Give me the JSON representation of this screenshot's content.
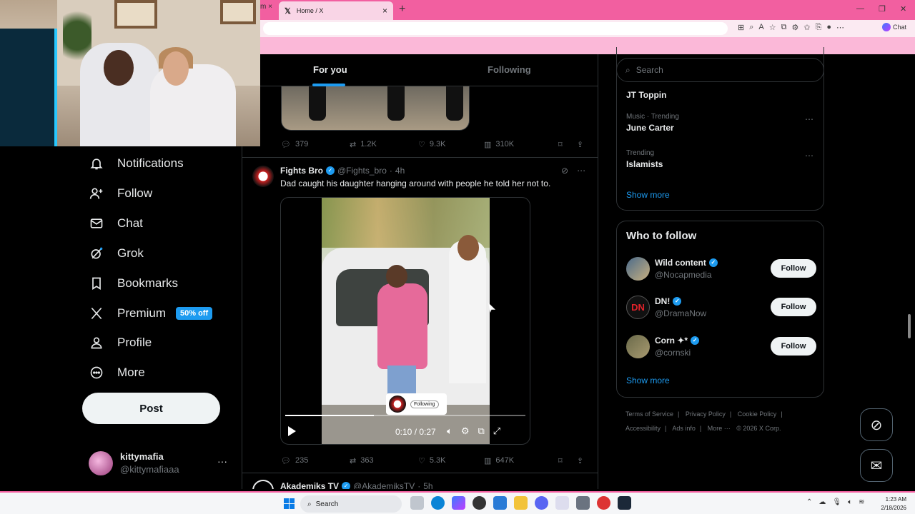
{
  "browser": {
    "tab_title": "Home / X",
    "tab_close": "×",
    "new_tab": "+",
    "chat_label": "Chat"
  },
  "nav": {
    "items": [
      {
        "label": "Notifications",
        "icon": "bell-icon"
      },
      {
        "label": "Follow",
        "icon": "person-plus-icon"
      },
      {
        "label": "Chat",
        "icon": "envelope-icon"
      },
      {
        "label": "Grok",
        "icon": "grok-icon"
      },
      {
        "label": "Bookmarks",
        "icon": "bookmark-icon"
      },
      {
        "label": "Premium",
        "icon": "x-logo-icon"
      },
      {
        "label": "Profile",
        "icon": "person-icon"
      },
      {
        "label": "More",
        "icon": "more-circle-icon"
      }
    ],
    "premium_badge": "50% off",
    "post_button": "Post",
    "account": {
      "name": "kittymafia",
      "handle": "@kittymafiaaa",
      "more": "···"
    }
  },
  "feed": {
    "tabs": [
      {
        "label": "For you"
      },
      {
        "label": "Following"
      }
    ],
    "prev_actions": {
      "replies": "379",
      "reposts": "1.2K",
      "likes": "9.3K",
      "views": "310K"
    },
    "tweet": {
      "name": "Fights Bro",
      "handle": "@Fights_bro",
      "sep": "·",
      "time": "4h",
      "text": "Dad caught his daughter hanging around with people he told her not to.",
      "video": {
        "time": "0:10 / 0:27",
        "progress": 0.37,
        "overlay_button": "Following"
      },
      "actions": {
        "replies": "235",
        "reposts": "363",
        "likes": "5.3K",
        "views": "647K"
      }
    },
    "next_tweet": {
      "name": "Akademiks TV",
      "handle": "@AkademiksTV",
      "sep": "·",
      "time": "5h"
    }
  },
  "right": {
    "search_placeholder": "Search",
    "trends": [
      {
        "meta": "",
        "title": "JT Toppin"
      },
      {
        "meta": "Music · Trending",
        "title": "June Carter"
      },
      {
        "meta": "Trending",
        "title": "Islamists"
      }
    ],
    "show_more": "Show more",
    "who_to_follow": {
      "title": "Who to follow",
      "accounts": [
        {
          "name": "Wild content",
          "handle": "@Nocapmedia",
          "button": "Follow"
        },
        {
          "name": "DN!",
          "handle": "@DramaNow",
          "button": "Follow"
        },
        {
          "name": "Corn ✦*",
          "handle": "@cornski",
          "button": "Follow"
        }
      ],
      "show_more": "Show more"
    },
    "footer": [
      "Terms of Service",
      "|",
      "Privacy Policy",
      "|",
      "Cookie Policy",
      "|",
      "Accessibility",
      "|",
      "Ads info",
      "|",
      "More ···",
      "© 2026 X Corp."
    ]
  },
  "taskbar": {
    "search_label": "Search",
    "time": "1:23 AM",
    "date": "2/18/2026"
  }
}
